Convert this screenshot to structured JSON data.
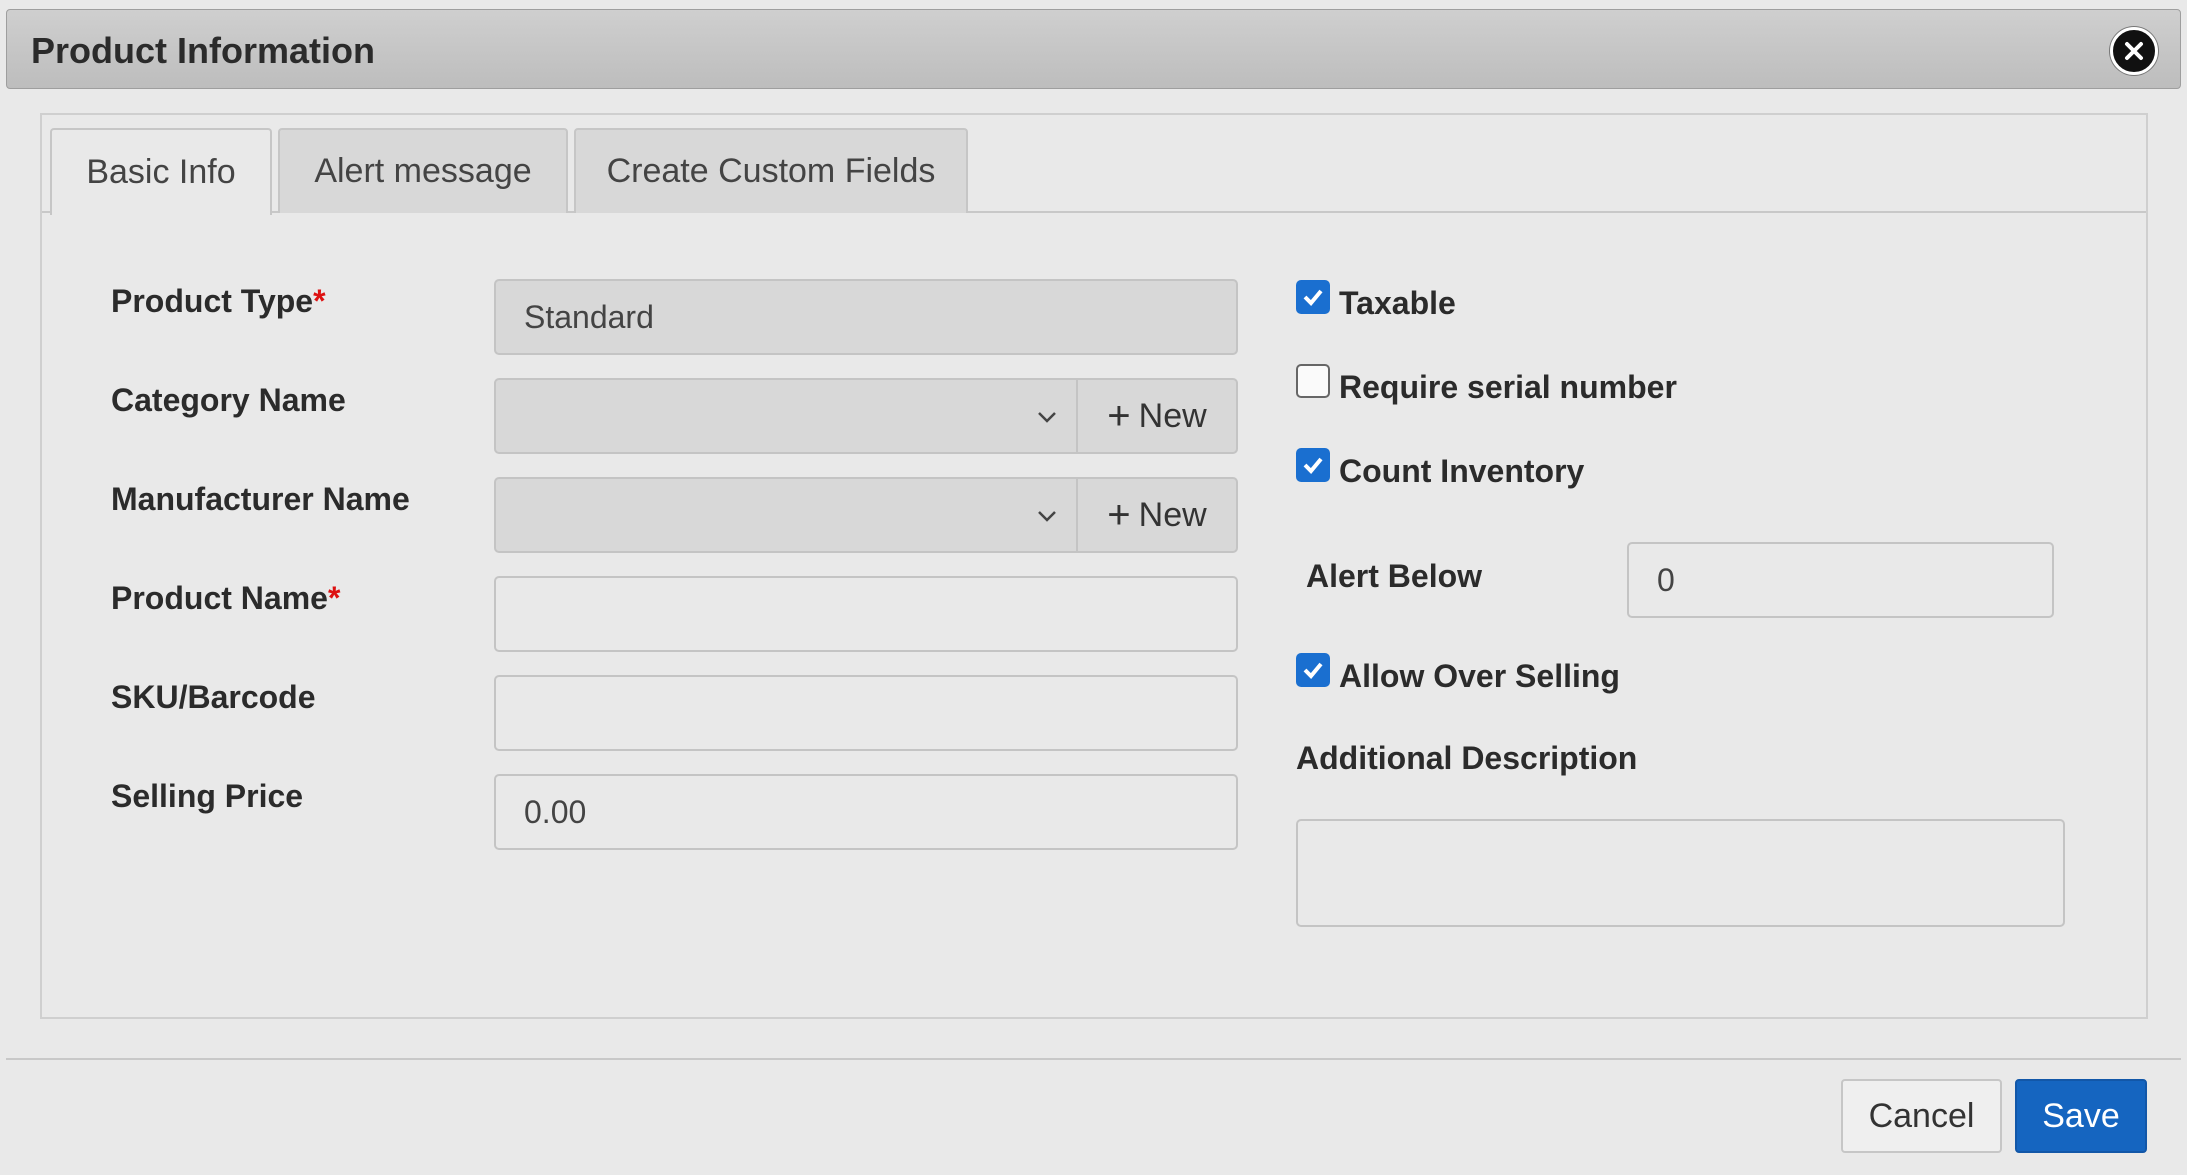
{
  "dialog": {
    "title": "Product Information"
  },
  "tabs": [
    {
      "label": "Basic Info",
      "active": true
    },
    {
      "label": "Alert message",
      "active": false
    },
    {
      "label": "Create Custom Fields",
      "active": false
    }
  ],
  "form": {
    "product_type": {
      "label": "Product Type",
      "required_mark": "*",
      "value": "Standard"
    },
    "category_name": {
      "label": "Category Name",
      "value": "",
      "new_label": "New"
    },
    "manufacturer_name": {
      "label": "Manufacturer Name",
      "value": "",
      "new_label": "New"
    },
    "product_name": {
      "label": "Product Name",
      "required_mark": "*",
      "value": ""
    },
    "sku_barcode": {
      "label": "SKU/Barcode",
      "value": ""
    },
    "selling_price": {
      "label": "Selling Price",
      "value": "0.00"
    }
  },
  "options": {
    "taxable": {
      "label": "Taxable",
      "checked": true
    },
    "require_serial": {
      "label": "Require serial number",
      "checked": false
    },
    "count_inventory": {
      "label": "Count Inventory",
      "checked": true
    },
    "alert_below": {
      "label": "Alert Below",
      "value": "0"
    },
    "allow_over_selling": {
      "label": "Allow Over Selling",
      "checked": true
    },
    "additional_description": {
      "label": "Additional Description",
      "value": ""
    }
  },
  "footer": {
    "cancel_label": "Cancel",
    "save_label": "Save"
  },
  "colors": {
    "accent": "#1565c0",
    "checkbox": "#1a6fd0",
    "required": "#dd1111"
  }
}
